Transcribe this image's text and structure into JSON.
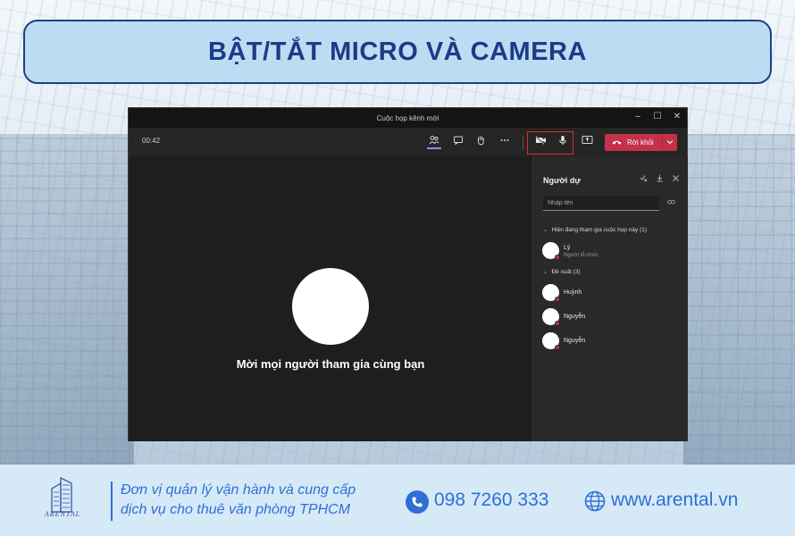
{
  "banner": {
    "title": "BẬT/TẮT MICRO VÀ CAMERA"
  },
  "window": {
    "title": "Cuộc họp kênh mới",
    "controls": [
      "–",
      "☐",
      "✕"
    ]
  },
  "toolbar": {
    "timer": "00:42",
    "icons": [
      "participants-icon",
      "chat-icon",
      "raise-hand-icon",
      "more-icon",
      "camera-off-icon",
      "microphone-icon",
      "share-screen-icon"
    ],
    "leave_label": "Rời khỏi"
  },
  "stage": {
    "invite_text": "Mời mọi người tham gia cùng bạn"
  },
  "panel": {
    "title": "Người dự",
    "search_placeholder": "Nhập tên",
    "in_meeting_heading": "Hiện đang tham gia cuộc họp này (1)",
    "in_meeting": [
      {
        "name": "Lý",
        "role": "Người tổ chức"
      }
    ],
    "suggested_heading": "Đề xuất (3)",
    "suggested": [
      {
        "name": "Huỳnh"
      },
      {
        "name": "Nguyễn"
      },
      {
        "name": "Nguyễn"
      }
    ]
  },
  "footer": {
    "logo_text": "ARENTAL",
    "tagline_line1": "Đơn vị quản lý vận hành và cung cấp",
    "tagline_line2": "dịch vụ cho thuê văn phòng TPHCM",
    "phone": "098 7260 333",
    "website": "www.arental.vn"
  },
  "colors": {
    "banner_border": "#1f3f86",
    "banner_fill": "#bcdcf3",
    "leave_button": "#c4314b",
    "highlight_box": "#e02b2b",
    "footer_text": "#2f6fd6"
  }
}
